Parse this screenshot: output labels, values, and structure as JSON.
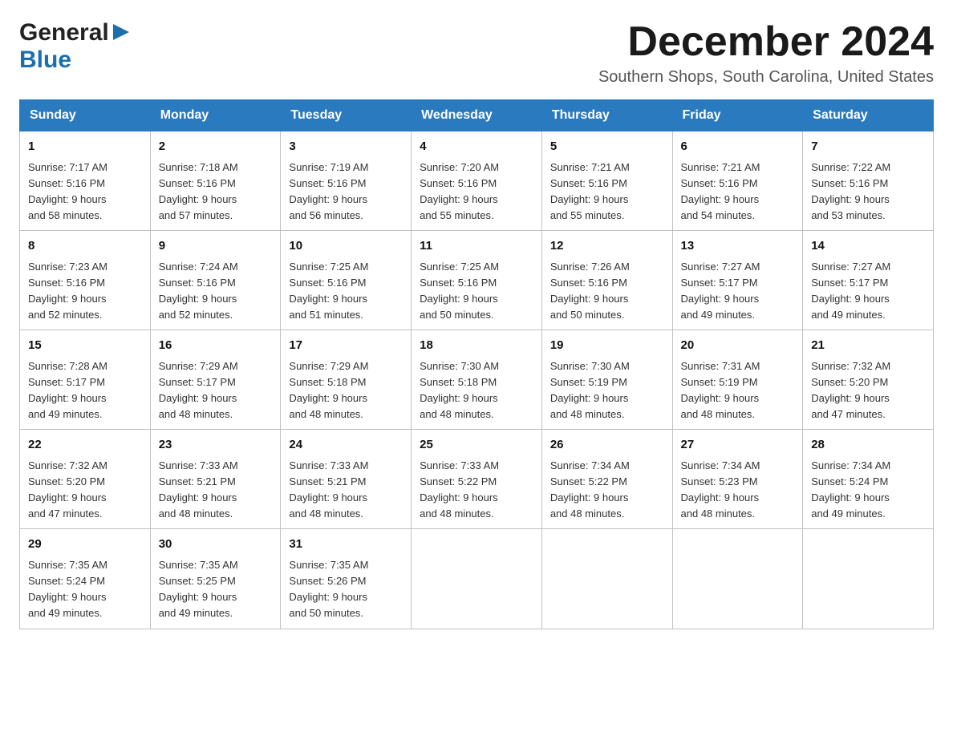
{
  "header": {
    "logo_general": "General",
    "logo_blue": "Blue",
    "month_title": "December 2024",
    "location": "Southern Shops, South Carolina, United States"
  },
  "days_of_week": [
    "Sunday",
    "Monday",
    "Tuesday",
    "Wednesday",
    "Thursday",
    "Friday",
    "Saturday"
  ],
  "weeks": [
    [
      {
        "day": "1",
        "sunrise": "7:17 AM",
        "sunset": "5:16 PM",
        "daylight": "9 hours and 58 minutes."
      },
      {
        "day": "2",
        "sunrise": "7:18 AM",
        "sunset": "5:16 PM",
        "daylight": "9 hours and 57 minutes."
      },
      {
        "day": "3",
        "sunrise": "7:19 AM",
        "sunset": "5:16 PM",
        "daylight": "9 hours and 56 minutes."
      },
      {
        "day": "4",
        "sunrise": "7:20 AM",
        "sunset": "5:16 PM",
        "daylight": "9 hours and 55 minutes."
      },
      {
        "day": "5",
        "sunrise": "7:21 AM",
        "sunset": "5:16 PM",
        "daylight": "9 hours and 55 minutes."
      },
      {
        "day": "6",
        "sunrise": "7:21 AM",
        "sunset": "5:16 PM",
        "daylight": "9 hours and 54 minutes."
      },
      {
        "day": "7",
        "sunrise": "7:22 AM",
        "sunset": "5:16 PM",
        "daylight": "9 hours and 53 minutes."
      }
    ],
    [
      {
        "day": "8",
        "sunrise": "7:23 AM",
        "sunset": "5:16 PM",
        "daylight": "9 hours and 52 minutes."
      },
      {
        "day": "9",
        "sunrise": "7:24 AM",
        "sunset": "5:16 PM",
        "daylight": "9 hours and 52 minutes."
      },
      {
        "day": "10",
        "sunrise": "7:25 AM",
        "sunset": "5:16 PM",
        "daylight": "9 hours and 51 minutes."
      },
      {
        "day": "11",
        "sunrise": "7:25 AM",
        "sunset": "5:16 PM",
        "daylight": "9 hours and 50 minutes."
      },
      {
        "day": "12",
        "sunrise": "7:26 AM",
        "sunset": "5:16 PM",
        "daylight": "9 hours and 50 minutes."
      },
      {
        "day": "13",
        "sunrise": "7:27 AM",
        "sunset": "5:17 PM",
        "daylight": "9 hours and 49 minutes."
      },
      {
        "day": "14",
        "sunrise": "7:27 AM",
        "sunset": "5:17 PM",
        "daylight": "9 hours and 49 minutes."
      }
    ],
    [
      {
        "day": "15",
        "sunrise": "7:28 AM",
        "sunset": "5:17 PM",
        "daylight": "9 hours and 49 minutes."
      },
      {
        "day": "16",
        "sunrise": "7:29 AM",
        "sunset": "5:17 PM",
        "daylight": "9 hours and 48 minutes."
      },
      {
        "day": "17",
        "sunrise": "7:29 AM",
        "sunset": "5:18 PM",
        "daylight": "9 hours and 48 minutes."
      },
      {
        "day": "18",
        "sunrise": "7:30 AM",
        "sunset": "5:18 PM",
        "daylight": "9 hours and 48 minutes."
      },
      {
        "day": "19",
        "sunrise": "7:30 AM",
        "sunset": "5:19 PM",
        "daylight": "9 hours and 48 minutes."
      },
      {
        "day": "20",
        "sunrise": "7:31 AM",
        "sunset": "5:19 PM",
        "daylight": "9 hours and 48 minutes."
      },
      {
        "day": "21",
        "sunrise": "7:32 AM",
        "sunset": "5:20 PM",
        "daylight": "9 hours and 47 minutes."
      }
    ],
    [
      {
        "day": "22",
        "sunrise": "7:32 AM",
        "sunset": "5:20 PM",
        "daylight": "9 hours and 47 minutes."
      },
      {
        "day": "23",
        "sunrise": "7:33 AM",
        "sunset": "5:21 PM",
        "daylight": "9 hours and 48 minutes."
      },
      {
        "day": "24",
        "sunrise": "7:33 AM",
        "sunset": "5:21 PM",
        "daylight": "9 hours and 48 minutes."
      },
      {
        "day": "25",
        "sunrise": "7:33 AM",
        "sunset": "5:22 PM",
        "daylight": "9 hours and 48 minutes."
      },
      {
        "day": "26",
        "sunrise": "7:34 AM",
        "sunset": "5:22 PM",
        "daylight": "9 hours and 48 minutes."
      },
      {
        "day": "27",
        "sunrise": "7:34 AM",
        "sunset": "5:23 PM",
        "daylight": "9 hours and 48 minutes."
      },
      {
        "day": "28",
        "sunrise": "7:34 AM",
        "sunset": "5:24 PM",
        "daylight": "9 hours and 49 minutes."
      }
    ],
    [
      {
        "day": "29",
        "sunrise": "7:35 AM",
        "sunset": "5:24 PM",
        "daylight": "9 hours and 49 minutes."
      },
      {
        "day": "30",
        "sunrise": "7:35 AM",
        "sunset": "5:25 PM",
        "daylight": "9 hours and 49 minutes."
      },
      {
        "day": "31",
        "sunrise": "7:35 AM",
        "sunset": "5:26 PM",
        "daylight": "9 hours and 50 minutes."
      },
      null,
      null,
      null,
      null
    ]
  ],
  "labels": {
    "sunrise_prefix": "Sunrise: ",
    "sunset_prefix": "Sunset: ",
    "daylight_prefix": "Daylight: "
  }
}
